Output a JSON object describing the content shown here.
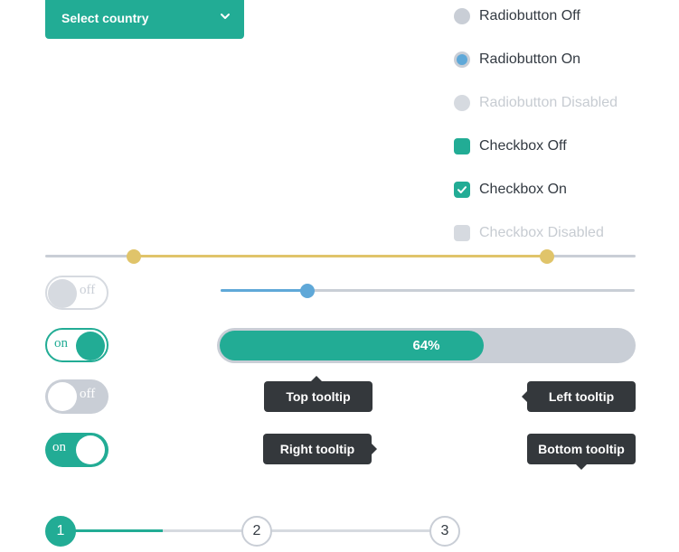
{
  "select": {
    "label": "Select country",
    "icon": "chevron-down-icon"
  },
  "options": [
    {
      "type": "radio",
      "state": "off",
      "label": "Radiobutton Off"
    },
    {
      "type": "radio",
      "state": "on",
      "label": "Radiobutton On"
    },
    {
      "type": "radio",
      "state": "disabled",
      "label": "Radiobutton Disabled"
    },
    {
      "type": "checkbox",
      "state": "off",
      "label": "Checkbox Off"
    },
    {
      "type": "checkbox",
      "state": "on",
      "label": "Checkbox On"
    },
    {
      "type": "checkbox",
      "state": "disabled",
      "label": "Checkbox Disabled"
    }
  ],
  "range_slider": {
    "low": 0.15,
    "high": 0.85
  },
  "single_slider": {
    "value": 0.21
  },
  "toggles": [
    {
      "label": "off",
      "state": "off",
      "disabled": true
    },
    {
      "label": "on",
      "state": "on",
      "disabled": false
    },
    {
      "label": "off",
      "state": "off",
      "disabled": false
    },
    {
      "label": "on",
      "state": "on",
      "disabled": false
    }
  ],
  "progress": {
    "value": 64,
    "label": "64%"
  },
  "tooltips": {
    "top": "Top tooltip",
    "left": "Left tooltip",
    "right": "Right tooltip",
    "bottom": "Bottom tooltip"
  },
  "stepper": {
    "steps": [
      "1",
      "2",
      "3"
    ],
    "active": 0
  },
  "colors": {
    "primary": "#22ac95",
    "accent_blue": "#5fa8d8",
    "range_gold": "#e0c46a",
    "neutral": "#c9ced6",
    "disabled": "#d6dae0",
    "tooltip_bg": "#34383c",
    "text": "#333a42"
  }
}
